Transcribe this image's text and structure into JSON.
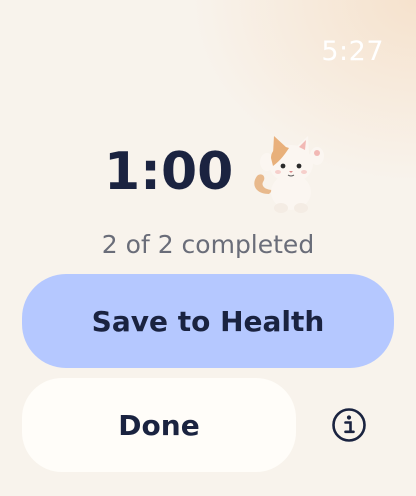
{
  "status_bar": {
    "time": "5:27"
  },
  "workout": {
    "timer": "1:00",
    "progress": "2 of 2 completed",
    "mascot_icon": "cat-icon"
  },
  "actions": {
    "save_label": "Save to Health",
    "done_label": "Done",
    "info_icon": "info-icon"
  },
  "colors": {
    "accent": "#b5c8ff",
    "text_dark": "#1a2340",
    "secondary_text": "#6a6d79",
    "background": "#f8f3ec"
  }
}
